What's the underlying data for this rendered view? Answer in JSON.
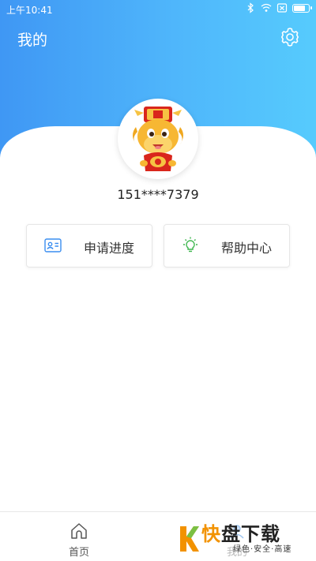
{
  "status_bar": {
    "time": "上午10:41",
    "battery_level": 0.85
  },
  "header": {
    "title": "我的"
  },
  "profile": {
    "phone": "151****7379"
  },
  "actions": [
    {
      "label": "申请进度",
      "icon": "id-card-icon"
    },
    {
      "label": "帮助中心",
      "icon": "lightbulb-icon"
    }
  ],
  "tabbar": {
    "home_label": "首页",
    "mine_label": "我的"
  },
  "watermark": {
    "brand_accent": "快",
    "brand_rest": "盘下载",
    "slogan": "绿色·安全·高速"
  },
  "colors": {
    "header_start": "#3f97f4",
    "header_end": "#56cbfd",
    "icon_blue": "#3a8df0",
    "icon_green": "#39b54a",
    "brand_orange": "#f29200"
  }
}
